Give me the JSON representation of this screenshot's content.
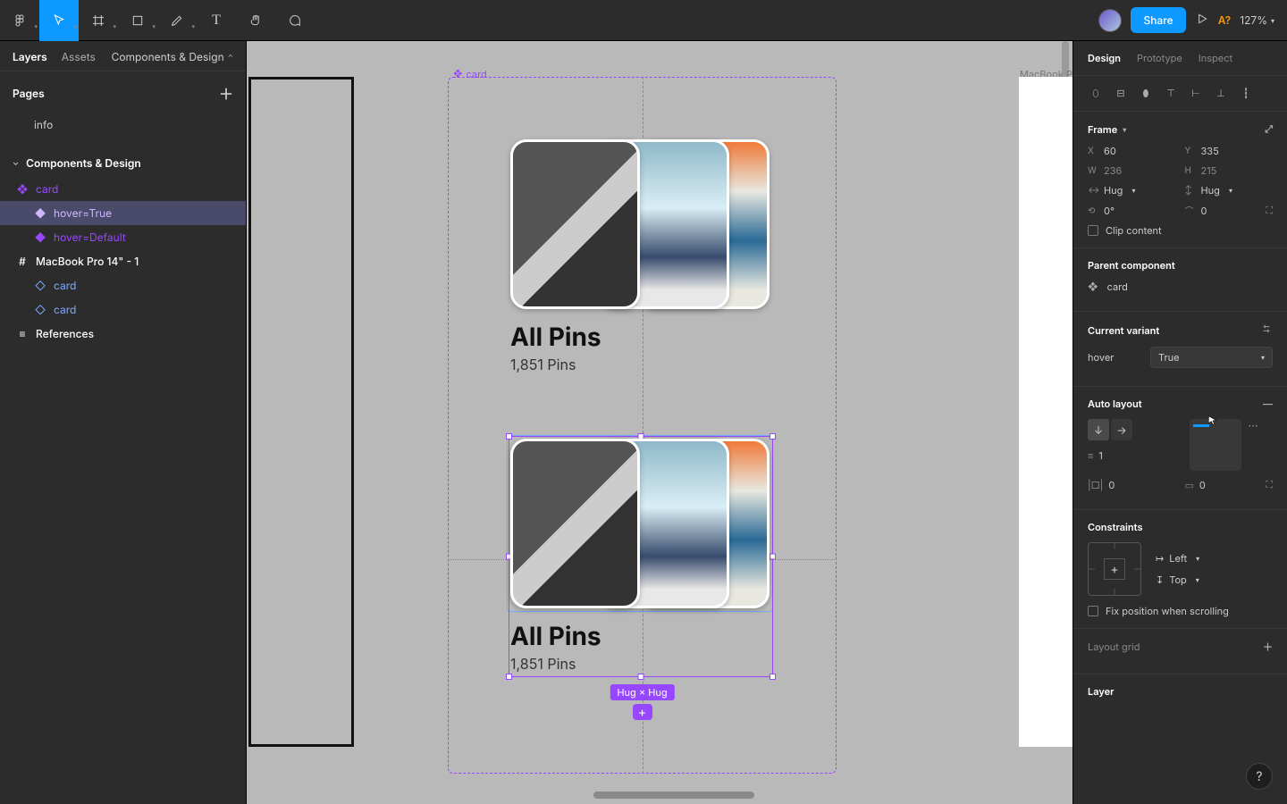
{
  "toolbar": {
    "share_label": "Share",
    "a_label": "A?",
    "zoom": "127%"
  },
  "left": {
    "tab_layers": "Layers",
    "tab_assets": "Assets",
    "file_name": "Components & Design",
    "pages_title": "Pages",
    "page_info": "info",
    "page_active": "Components & Design",
    "layer_card": "card",
    "variant_true": "hover=True",
    "variant_default": "hover=Default",
    "frame_macbook": "MacBook Pro 14\" - 1",
    "instance_card": "card",
    "references": "References"
  },
  "canvas": {
    "component_label": "card",
    "card_title": "All Pins",
    "card_sub": "1,851 Pins",
    "macbook_label": "MacBook Pr",
    "size_badge": "Hug × Hug"
  },
  "right": {
    "tab_design": "Design",
    "tab_prototype": "Prototype",
    "tab_inspect": "Inspect",
    "frame_title": "Frame",
    "x": "60",
    "y": "335",
    "w": "236",
    "h": "215",
    "hug1": "Hug",
    "hug2": "Hug",
    "rotation": "0°",
    "radius": "0",
    "clip": "Clip content",
    "parent_title": "Parent component",
    "parent_name": "card",
    "variant_title": "Current variant",
    "variant_prop": "hover",
    "variant_val": "True",
    "auto_layout_title": "Auto layout",
    "al_gap": "1",
    "al_pad_h": "0",
    "al_pad_v": "0",
    "constraints_title": "Constraints",
    "constraint_h": "Left",
    "constraint_v": "Top",
    "fix_scroll": "Fix position when scrolling",
    "layout_grid_title": "Layout grid",
    "layer_title": "Layer"
  }
}
